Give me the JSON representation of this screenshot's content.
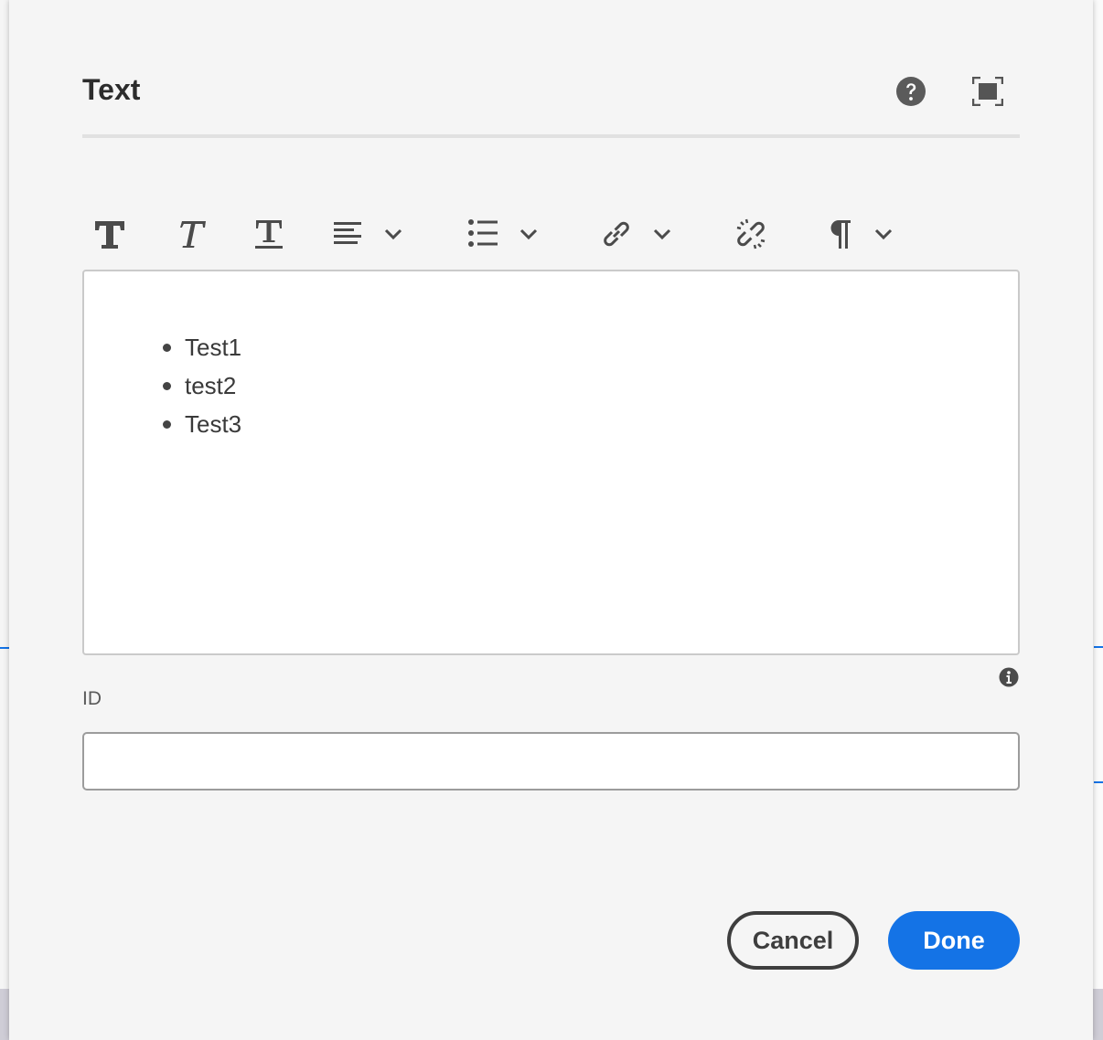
{
  "dialog": {
    "title": "Text",
    "help_icon": "help-circle-icon",
    "fullscreen_icon": "fullscreen-icon"
  },
  "toolbar": {
    "items": [
      {
        "name": "bold",
        "icon": "bold-icon"
      },
      {
        "name": "italic",
        "icon": "italic-icon"
      },
      {
        "name": "underline",
        "icon": "underline-icon"
      },
      {
        "name": "justify",
        "icon": "align-left-icon",
        "has_dropdown": true
      },
      {
        "name": "lists",
        "icon": "bullet-list-icon",
        "has_dropdown": true
      },
      {
        "name": "link",
        "icon": "link-icon",
        "has_dropdown": true
      },
      {
        "name": "unlink",
        "icon": "unlink-icon"
      },
      {
        "name": "paragraph",
        "icon": "paragraph-icon",
        "has_dropdown": true
      }
    ]
  },
  "editor": {
    "list_items": [
      "Test1",
      "test2",
      "Test3"
    ]
  },
  "id_field": {
    "label": "ID",
    "value": "",
    "info_icon": "info-icon"
  },
  "footer": {
    "cancel_label": "Cancel",
    "done_label": "Done"
  },
  "colors": {
    "accent": "#1473e6",
    "dialog_bg": "#f5f5f5",
    "icon": "#4b4b4b"
  }
}
